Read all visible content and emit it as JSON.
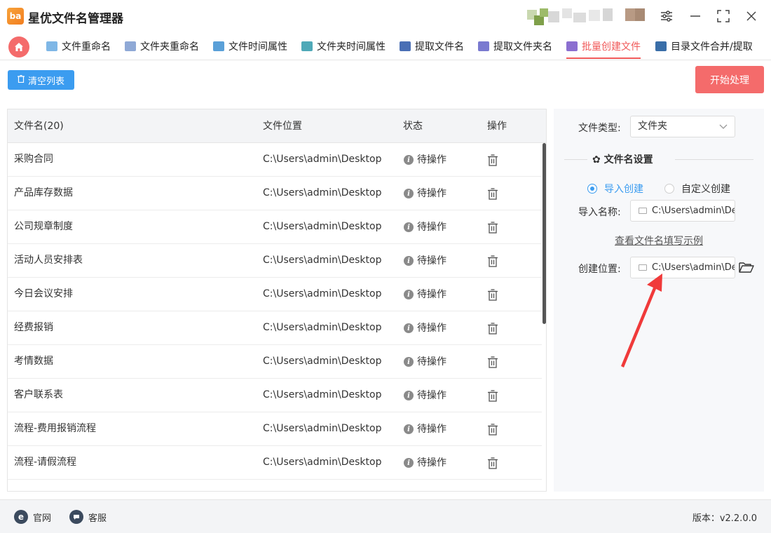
{
  "app": {
    "title": "星优文件名管理器",
    "logo_text": "ba"
  },
  "tabs": [
    {
      "label": "文件重命名",
      "color": "#7fb7e6"
    },
    {
      "label": "文件夹重命名",
      "color": "#8fa9d6"
    },
    {
      "label": "文件时间属性",
      "color": "#5aa0d8"
    },
    {
      "label": "文件夹时间属性",
      "color": "#4fa9b8"
    },
    {
      "label": "提取文件名",
      "color": "#4a6fb5"
    },
    {
      "label": "提取文件夹名",
      "color": "#7a7ad0"
    },
    {
      "label": "批量创建文件",
      "color": "#8b6fd0",
      "active": true
    },
    {
      "label": "目录文件合并/提取",
      "color": "#3a6ea8"
    }
  ],
  "toolbar": {
    "clear_label": "清空列表",
    "start_label": "开始处理"
  },
  "table": {
    "headers": {
      "name": "文件名(20)",
      "location": "文件位置",
      "status": "状态",
      "action": "操作"
    },
    "rows": [
      {
        "name": "采购合同",
        "location": "C:\\Users\\admin\\Desktop",
        "status": "待操作"
      },
      {
        "name": "产品库存数据",
        "location": "C:\\Users\\admin\\Desktop",
        "status": "待操作"
      },
      {
        "name": "公司规章制度",
        "location": "C:\\Users\\admin\\Desktop",
        "status": "待操作"
      },
      {
        "name": "活动人员安排表",
        "location": "C:\\Users\\admin\\Desktop",
        "status": "待操作"
      },
      {
        "name": "今日会议安排",
        "location": "C:\\Users\\admin\\Desktop",
        "status": "待操作"
      },
      {
        "name": "经费报销",
        "location": "C:\\Users\\admin\\Desktop",
        "status": "待操作"
      },
      {
        "name": "考情数据",
        "location": "C:\\Users\\admin\\Desktop",
        "status": "待操作"
      },
      {
        "name": "客户联系表",
        "location": "C:\\Users\\admin\\Desktop",
        "status": "待操作"
      },
      {
        "name": "流程-费用报销流程",
        "location": "C:\\Users\\admin\\Desktop",
        "status": "待操作"
      },
      {
        "name": "流程-请假流程",
        "location": "C:\\Users\\admin\\Desktop",
        "status": "待操作"
      }
    ]
  },
  "panel": {
    "file_type_label": "文件类型:",
    "file_type_value": "文件夹",
    "section_title": "文件名设置",
    "radio_import": "导入创建",
    "radio_custom": "自定义创建",
    "import_name_label": "导入名称:",
    "import_name_value": "C:\\Users\\admin\\De",
    "example_link": "查看文件名填写示例",
    "create_location_label": "创建位置:",
    "create_location_value": "C:\\Users\\admin\\Des"
  },
  "footer": {
    "website_label": "官网",
    "service_label": "客服",
    "version": "版本：v2.2.0.0"
  },
  "colors": {
    "accent_blue": "#3b9cf0",
    "accent_red": "#f46b6b",
    "arrow_red": "#f03a3a"
  }
}
